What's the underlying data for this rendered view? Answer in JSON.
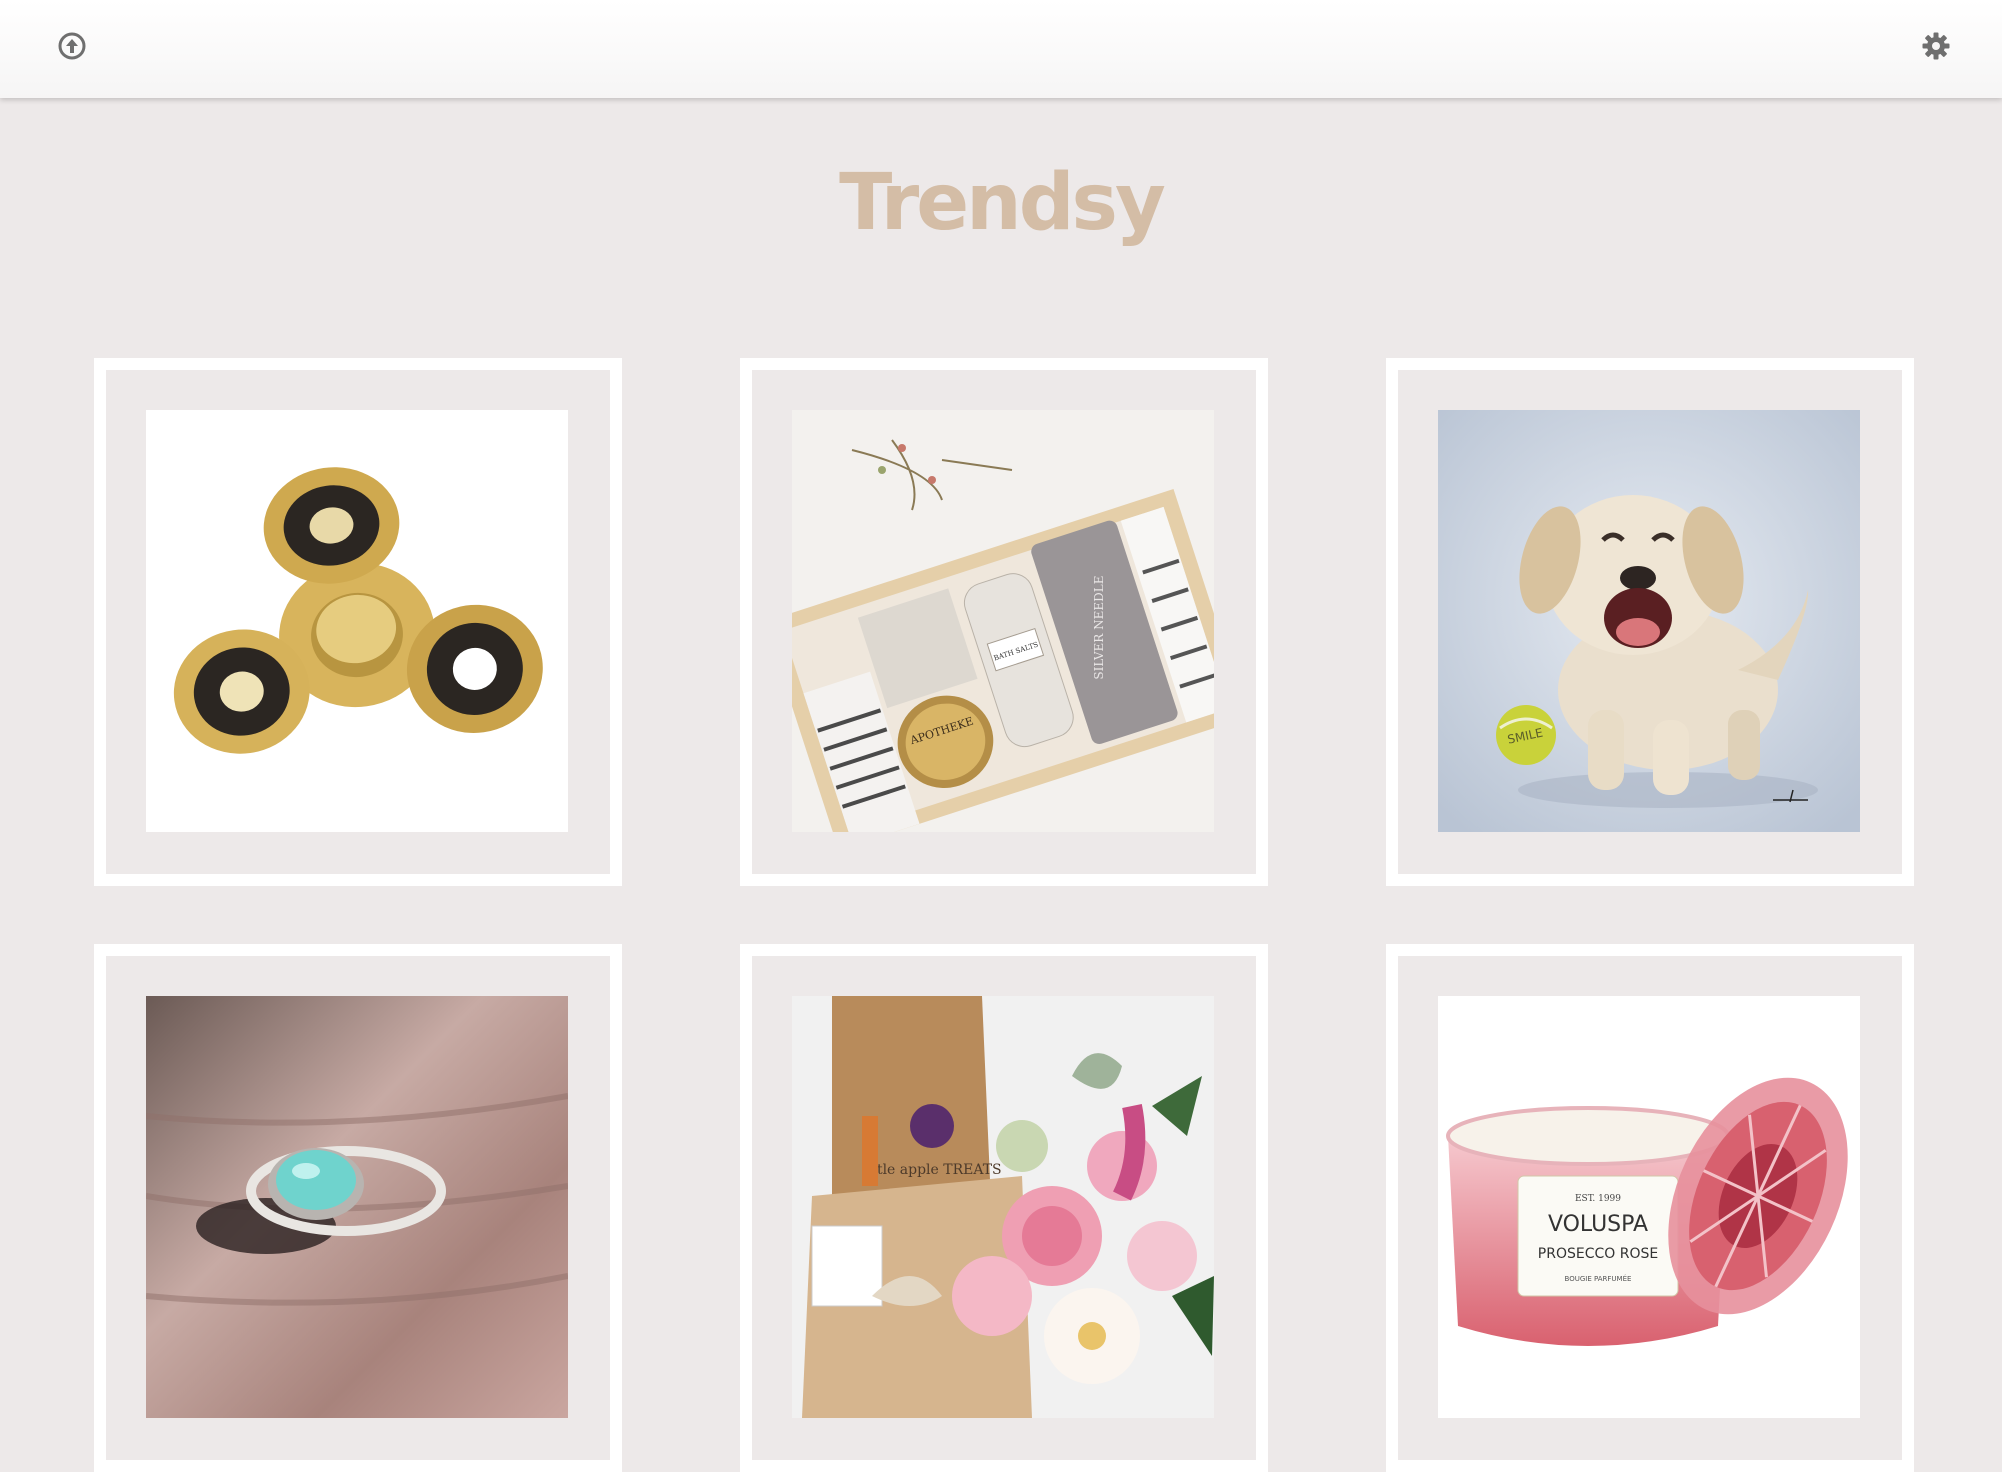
{
  "app": {
    "title": "Trendsy",
    "title_color": "#d4bda6",
    "background": "#ede9e9"
  },
  "topbar": {
    "left_icon": "circle-arrow-up-icon",
    "right_icon": "gear-icon"
  },
  "products": [
    {
      "image": "fidget-spinner-image"
    },
    {
      "image": "gift-box-image",
      "label_text": "SILVER NEEDLE",
      "jar_text": "APOTHEKE",
      "bottle_text": "BATH SALTS"
    },
    {
      "image": "puppy-painting-image",
      "ball_text": "SMILE"
    },
    {
      "image": "turquoise-ring-image"
    },
    {
      "image": "flower-gift-basket-image",
      "bag_text": "little apple TREATS"
    },
    {
      "image": "candle-image",
      "brand": "VOLUSPA",
      "est": "EST. 1999",
      "product": "PROSECCO ROSE",
      "sub": "BOUGIE PARFUMÉE"
    }
  ]
}
